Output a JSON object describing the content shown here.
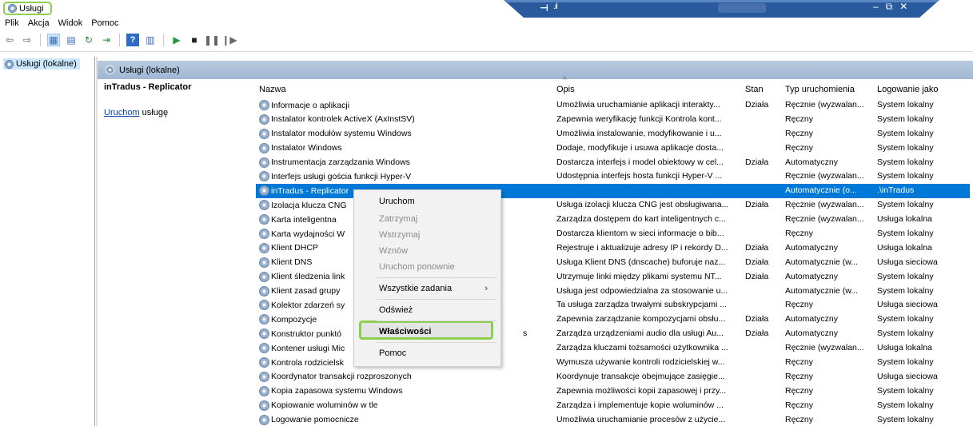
{
  "window": {
    "title": "Usługi"
  },
  "menubar": [
    "Plik",
    "Akcja",
    "Widok",
    "Pomoc"
  ],
  "toolbar_icons": [
    "back-arrow-icon",
    "forward-arrow-icon",
    "console-tree-icon",
    "properties-icon",
    "refresh-icon",
    "export-list-icon",
    "help-icon",
    "view-icon",
    "play-icon",
    "stop-icon",
    "pause-icon",
    "resume-icon"
  ],
  "tree": {
    "root_label": "Usługi (lokalne)"
  },
  "banner": {
    "label": "Usługi (lokalne)"
  },
  "details": {
    "service_title": "inTradus - Replicator",
    "action_link": "Uruchom",
    "action_suffix": " usługę"
  },
  "table": {
    "columns": [
      "Nazwa",
      "Opis",
      "Stan",
      "Typ uruchomienia",
      "Logowanie jako"
    ],
    "rows": [
      {
        "name": "Informacje o aplikacji",
        "desc": "Umożliwia uruchamianie aplikacji interakty...",
        "status": "Działa",
        "type": "Ręcznie (wyzwalan...",
        "logon": "System lokalny"
      },
      {
        "name": "Instalator kontrolek ActiveX (AxInstSV)",
        "desc": "Zapewnia weryfikację funkcji Kontrola kont...",
        "status": "",
        "type": "Ręczny",
        "logon": "System lokalny"
      },
      {
        "name": "Instalator modułów systemu Windows",
        "desc": "Umożliwia instalowanie, modyfikowanie i u...",
        "status": "",
        "type": "Ręczny",
        "logon": "System lokalny"
      },
      {
        "name": "Instalator Windows",
        "desc": "Dodaje, modyfikuje i usuwa aplikacje dosta...",
        "status": "",
        "type": "Ręczny",
        "logon": "System lokalny"
      },
      {
        "name": "Instrumentacja zarządzania Windows",
        "desc": "Dostarcza interfejs i model obiektowy w cel...",
        "status": "Działa",
        "type": "Automatyczny",
        "logon": "System lokalny"
      },
      {
        "name": "Interfejs usługi gościa funkcji Hyper-V",
        "desc": "Udostępnia interfejs hosta funkcji Hyper-V ...",
        "status": "",
        "type": "Ręcznie (wyzwalan...",
        "logon": "System lokalny"
      },
      {
        "name": "inTradus - Replicator",
        "desc": "",
        "status": "",
        "type": "Automatycznie (o...",
        "logon": ".\\inTradus"
      },
      {
        "name": "Izolacja klucza CNG",
        "desc": "Usługa izolacji klucza CNG jest obsługiwana...",
        "status": "Działa",
        "type": "Ręcznie (wyzwalan...",
        "logon": "System lokalny"
      },
      {
        "name": "Karta inteligentna",
        "desc": "Zarządza dostępem do kart inteligentnych c...",
        "status": "",
        "type": "Ręcznie (wyzwalan...",
        "logon": "Usługa lokalna"
      },
      {
        "name": "Karta wydajności W",
        "desc": "Dostarcza klientom w sieci informacje o bib...",
        "status": "",
        "type": "Ręczny",
        "logon": "System lokalny"
      },
      {
        "name": "Klient DHCP",
        "desc": "Rejestruje i aktualizuje adresy IP i rekordy D...",
        "status": "Działa",
        "type": "Automatyczny",
        "logon": "Usługa lokalna"
      },
      {
        "name": "Klient DNS",
        "desc": "Usługa Klient DNS (dnscache) buforuje naz...",
        "status": "Działa",
        "type": "Automatycznie (w...",
        "logon": "Usługa sieciowa"
      },
      {
        "name": "Klient śledzenia link",
        "desc": "Utrzymuje linki między plikami systemu NT...",
        "status": "Działa",
        "type": "Automatyczny",
        "logon": "System lokalny"
      },
      {
        "name": "Klient zasad grupy",
        "desc": "Usługa jest odpowiedzialna za stosowanie u...",
        "status": "",
        "type": "Automatycznie (w...",
        "logon": "System lokalny"
      },
      {
        "name": "Kolektor zdarzeń sy",
        "desc": "Ta usługa zarządza trwałymi subskrypcjami ...",
        "status": "",
        "type": "Ręczny",
        "logon": "Usługa sieciowa"
      },
      {
        "name": "Kompozycje",
        "desc": "Zapewnia zarządzanie kompozycjami obsłu...",
        "status": "Działa",
        "type": "Automatyczny",
        "logon": "System lokalny"
      },
      {
        "name": "Konstruktor punktó",
        "name_tail": "s",
        "desc": "Zarządza urządzeniami audio dla usługi Au...",
        "status": "Działa",
        "type": "Automatyczny",
        "logon": "System lokalny"
      },
      {
        "name": "Kontener usługi Mic",
        "desc": "Zarządza kluczami tożsamości użytkownika ...",
        "status": "",
        "type": "Ręcznie (wyzwalan...",
        "logon": "Usługa lokalna"
      },
      {
        "name": "Kontrola rodzicielsk",
        "desc": "Wymusza używanie kontroli rodzicielskiej w...",
        "status": "",
        "type": "Ręczny",
        "logon": "System lokalny"
      },
      {
        "name": "Koordynator transakcji rozproszonych",
        "desc": "Koordynuje transakcje obejmujące zasięgie...",
        "status": "",
        "type": "Ręczny",
        "logon": "Usługa sieciowa"
      },
      {
        "name": "Kopia zapasowa systemu Windows",
        "desc": "Zapewnia możliwości kopii zapasowej i przy...",
        "status": "",
        "type": "Ręczny",
        "logon": "System lokalny"
      },
      {
        "name": "Kopiowanie woluminów w tle",
        "desc": "Zarządza i implementuje kopie woluminów ...",
        "status": "",
        "type": "Ręczny",
        "logon": "System lokalny"
      },
      {
        "name": "Logowanie pomocnicze",
        "desc": "Umożliwia uruchamianie procesów z użycie...",
        "status": "",
        "type": "Ręczny",
        "logon": "System lokalny"
      }
    ]
  },
  "context_menu": {
    "items": [
      {
        "label": "Uruchom",
        "enabled": true
      },
      {
        "label": "Zatrzymaj",
        "enabled": false
      },
      {
        "label": "Wstrzymaj",
        "enabled": false
      },
      {
        "label": "Wznów",
        "enabled": false
      },
      {
        "label": "Uruchom ponownie",
        "enabled": false
      },
      {
        "label": "Wszystkie zadania",
        "enabled": true,
        "submenu": true
      },
      {
        "label": "Odśwież",
        "enabled": true
      },
      {
        "label": "Właściwości",
        "enabled": true,
        "highlighted": true
      },
      {
        "label": "Pomoc",
        "enabled": true
      }
    ],
    "submenu_arrow": "›"
  },
  "colors": {
    "selection": "#0078d7",
    "highlight_border": "#8ccf4e",
    "remote_bar": "#2a5a9e"
  }
}
